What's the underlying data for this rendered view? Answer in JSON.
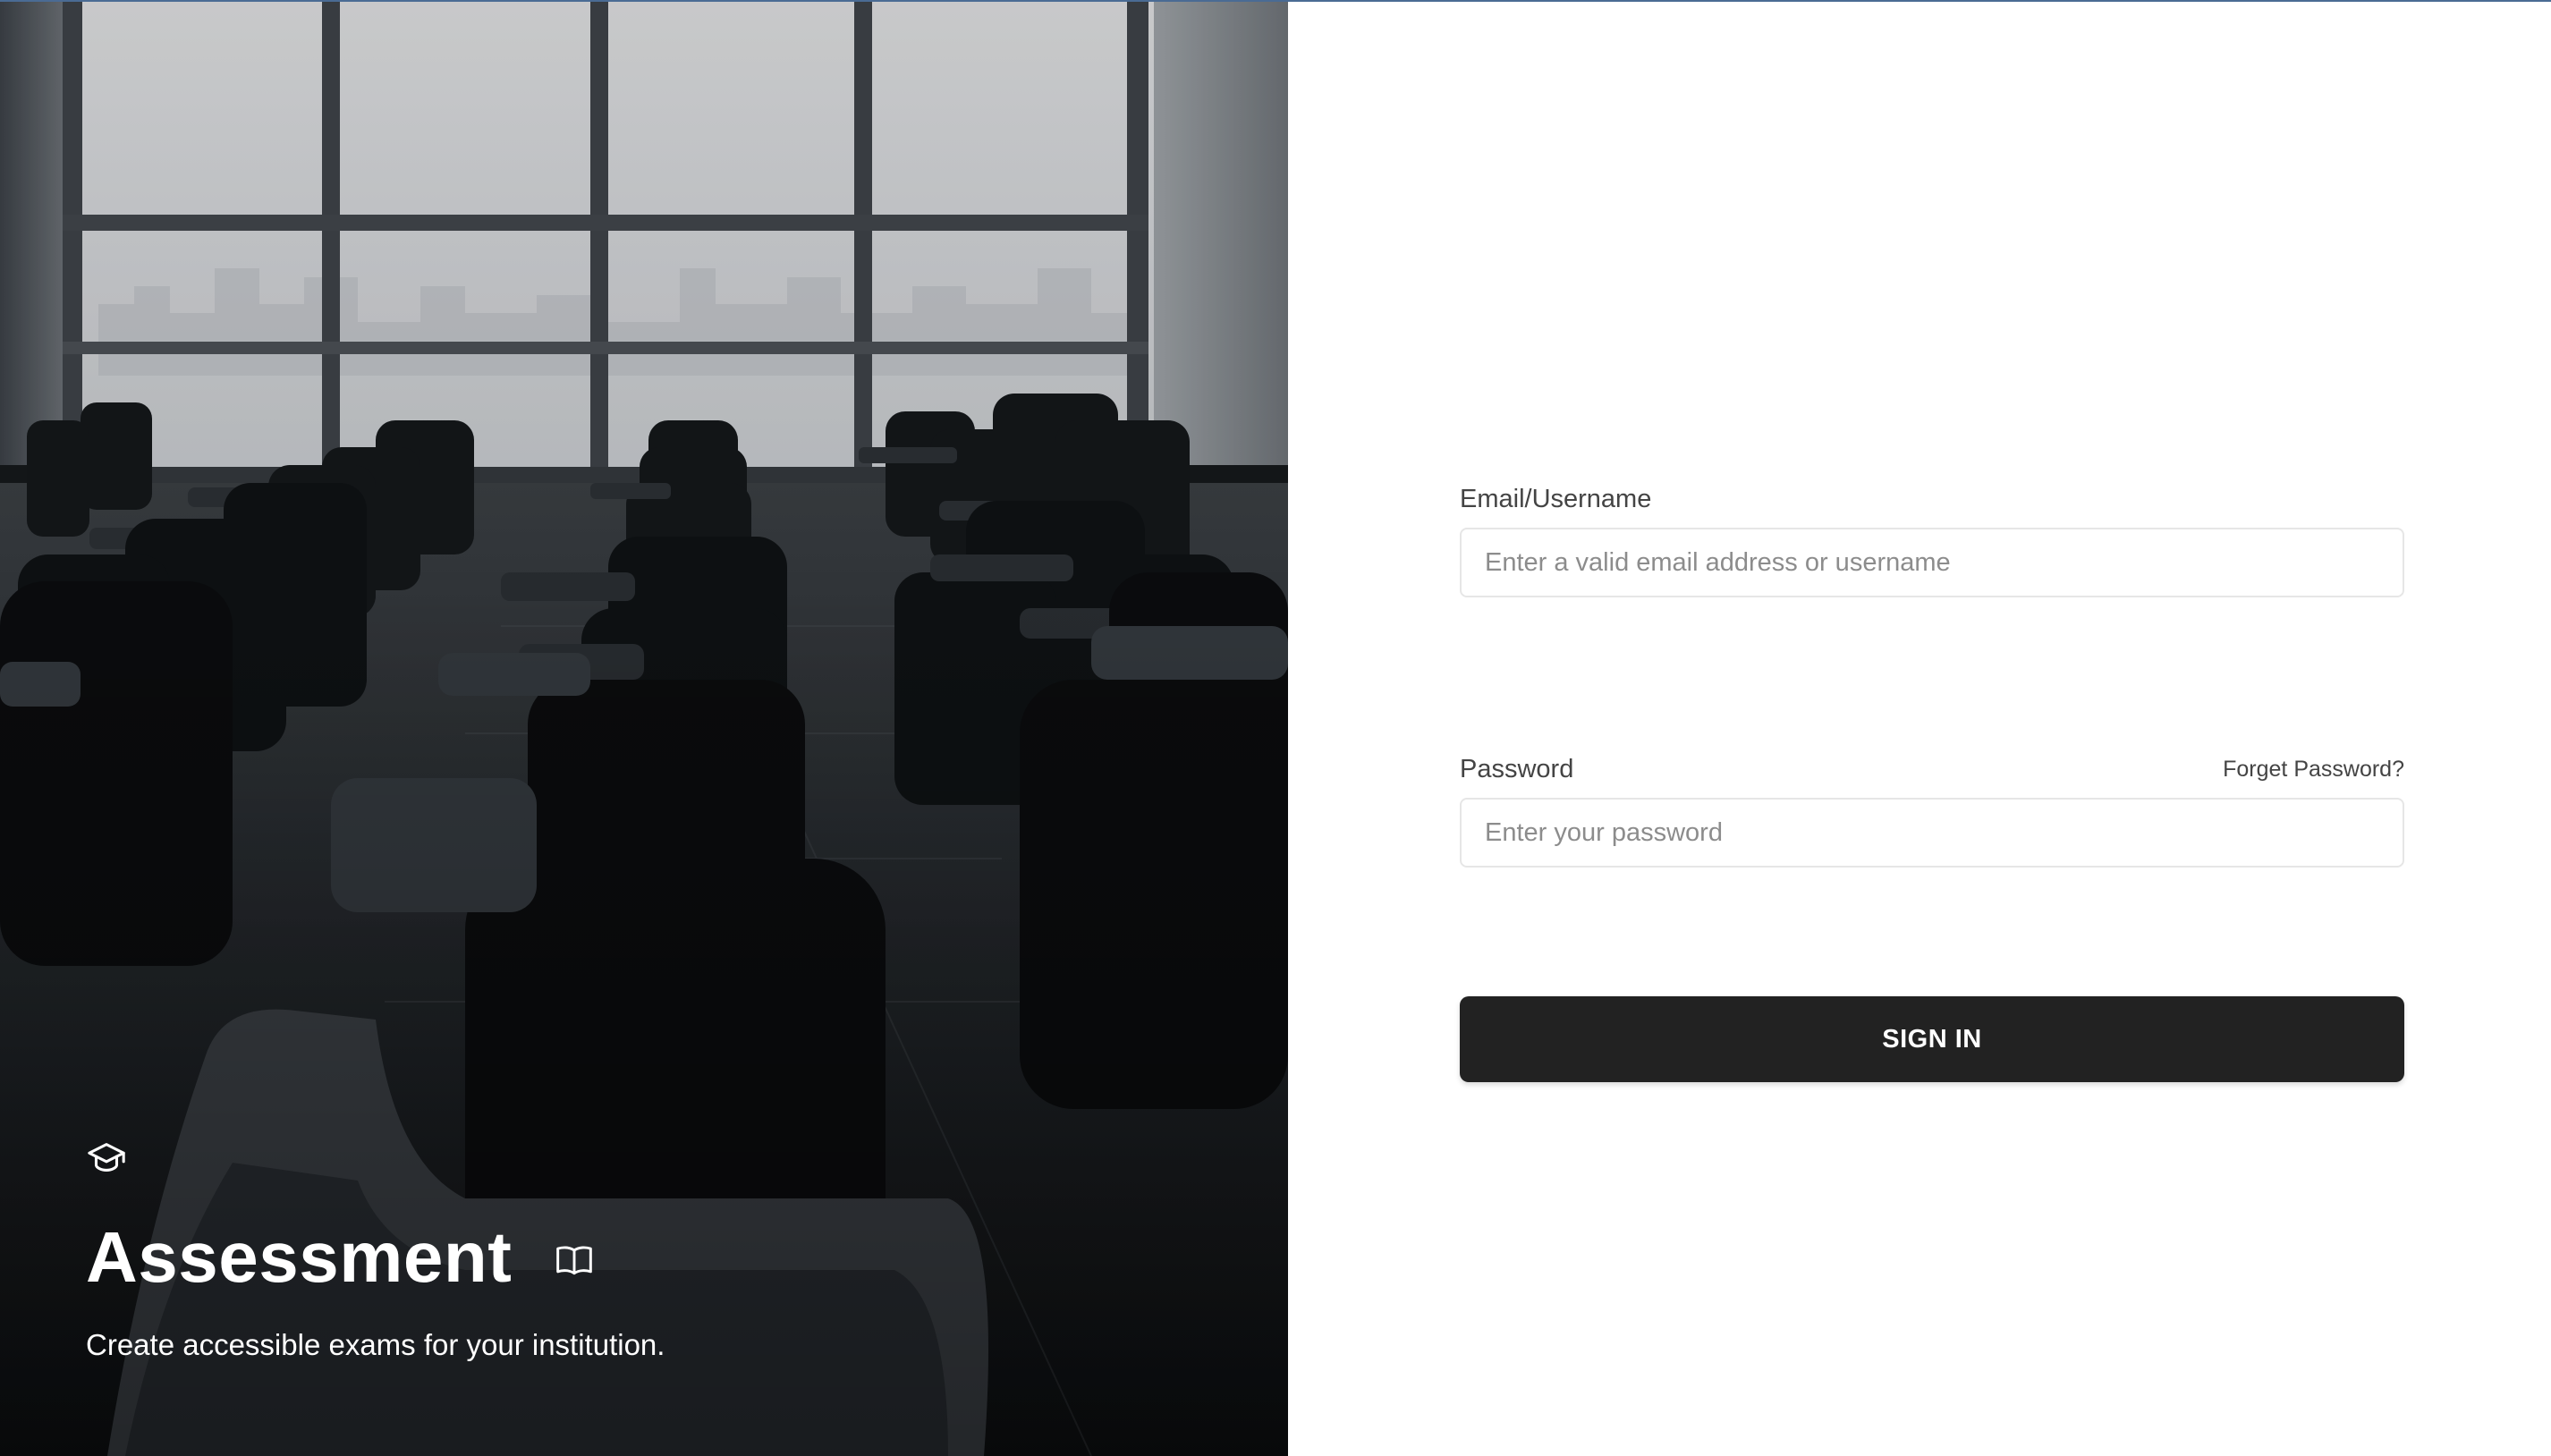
{
  "hero": {
    "title": "Assessment",
    "subtitle": "Create accessible exams for your institution.",
    "brand_icon": "graduation-cap-icon",
    "title_icon": "open-book-icon"
  },
  "form": {
    "email": {
      "label": "Email/Username",
      "placeholder": "Enter a valid email address or username",
      "value": ""
    },
    "password": {
      "label": "Password",
      "placeholder": "Enter your password",
      "value": "",
      "forgot_label": "Forget Password?"
    },
    "submit_label": "SIGN IN"
  },
  "colors": {
    "button_bg": "#222222",
    "button_text": "#ffffff",
    "label_text": "#444444",
    "input_border": "#e6e6e6",
    "top_border": "#4a6b94"
  }
}
